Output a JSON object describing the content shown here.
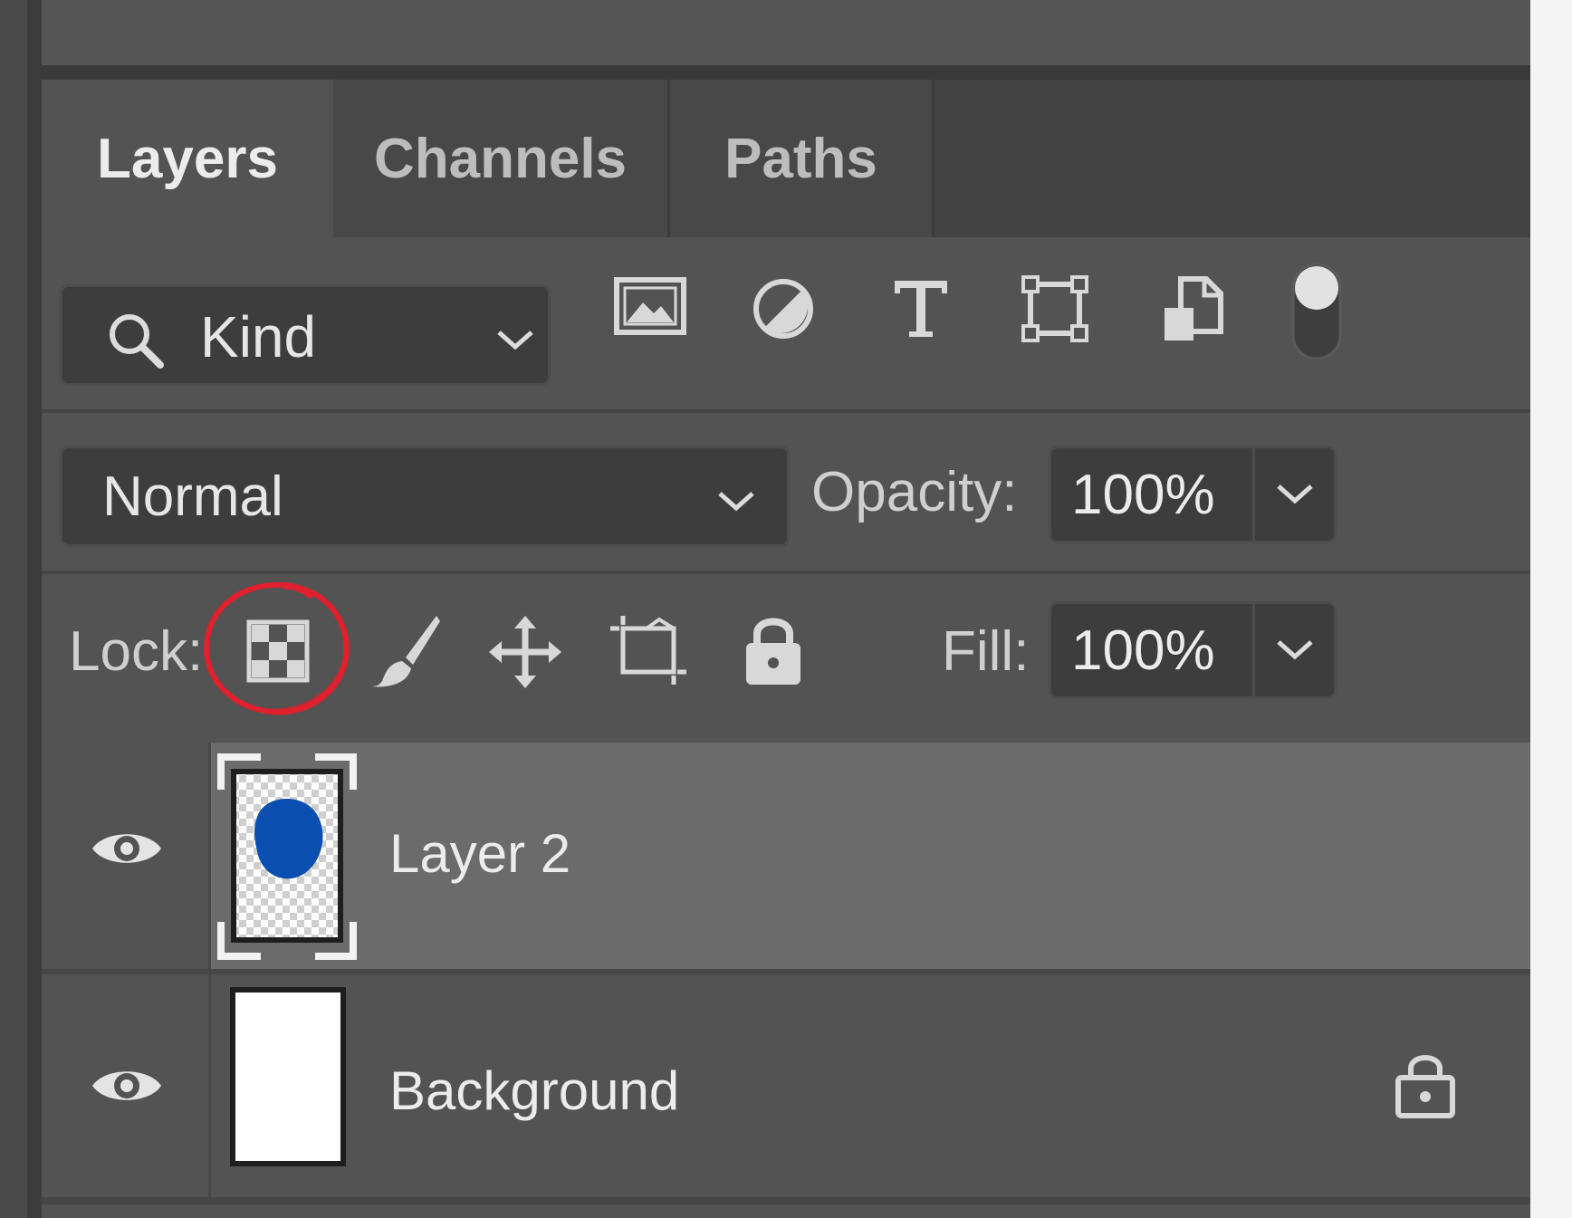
{
  "tabs": [
    {
      "label": "Layers",
      "active": true
    },
    {
      "label": "Channels",
      "active": false
    },
    {
      "label": "Paths",
      "active": false
    }
  ],
  "filter": {
    "kind_label": "Kind",
    "icons": [
      "image-filter-icon",
      "adjustment-filter-icon",
      "type-filter-icon",
      "shape-filter-icon",
      "smart-object-filter-icon"
    ],
    "toggle_on": true
  },
  "blend": {
    "mode": "Normal",
    "opacity_label": "Opacity:",
    "opacity_value": "100%"
  },
  "lock": {
    "label": "Lock:",
    "icons": [
      "lock-transparent-pixels-icon",
      "lock-image-pixels-icon",
      "lock-position-icon",
      "lock-artboard-icon",
      "lock-all-icon"
    ],
    "highlighted": "lock-transparent-pixels-icon",
    "fill_label": "Fill:",
    "fill_value": "100%"
  },
  "layers": [
    {
      "name": "Layer 2",
      "selected": true,
      "visible": true,
      "thumbnail_color": "#0a4fb0",
      "locked": false
    },
    {
      "name": "Background",
      "selected": false,
      "visible": true,
      "thumbnail_color": "#ffffff",
      "locked": true
    }
  ],
  "colors": {
    "panel": "#535353",
    "selected_row": "#6b6b6b",
    "annotation": "#e0202c"
  }
}
